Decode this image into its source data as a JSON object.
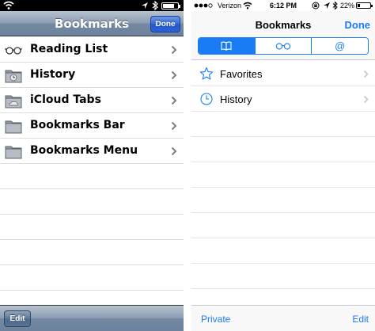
{
  "colors": {
    "ios7_accent": "#1a7cf5",
    "ios6_done": "#2a62d9",
    "ios6_bar": "#8a9bb1"
  },
  "left": {
    "status": {
      "battery_level": 0.8
    },
    "navbar": {
      "title": "Bookmarks",
      "done_label": "Done"
    },
    "items": [
      {
        "label": "Reading List",
        "icon": "glasses-icon"
      },
      {
        "label": "History",
        "icon": "history-folder-icon"
      },
      {
        "label": "iCloud Tabs",
        "icon": "cloud-folder-icon"
      },
      {
        "label": "Bookmarks Bar",
        "icon": "folder-icon"
      },
      {
        "label": "Bookmarks Menu",
        "icon": "folder-icon"
      }
    ],
    "toolbar": {
      "edit_label": "Edit"
    }
  },
  "right": {
    "status": {
      "carrier": "Verizon",
      "time": "6:12 PM",
      "battery": "22%",
      "battery_level": 0.22
    },
    "navbar": {
      "title": "Bookmarks",
      "done_label": "Done"
    },
    "segments": [
      {
        "icon": "book-icon",
        "selected": true
      },
      {
        "icon": "glasses-icon",
        "selected": false
      },
      {
        "icon": "at-icon",
        "label": "@",
        "selected": false
      }
    ],
    "items": [
      {
        "label": "Favorites",
        "icon": "star-icon"
      },
      {
        "label": "History",
        "icon": "clock-icon"
      }
    ],
    "toolbar": {
      "private_label": "Private",
      "edit_label": "Edit"
    }
  }
}
